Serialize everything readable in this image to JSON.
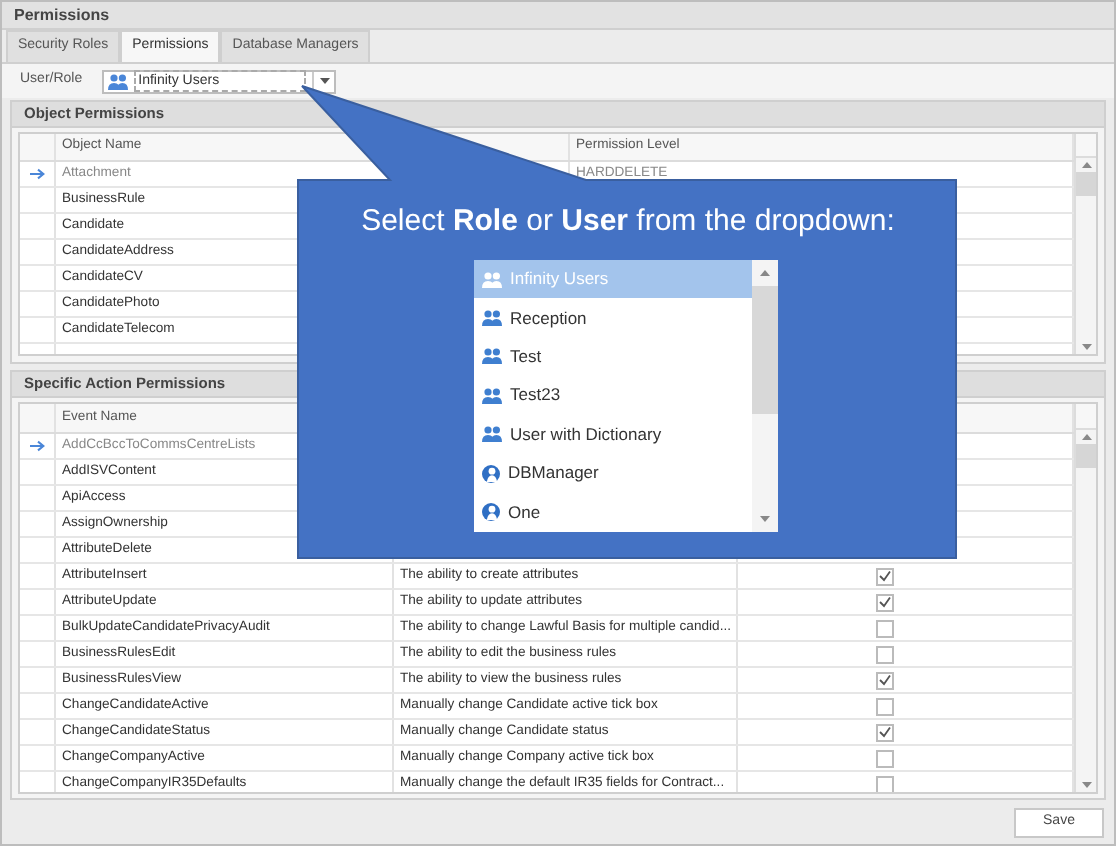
{
  "window": {
    "title": "Permissions"
  },
  "tabs": [
    {
      "label": "Security Roles",
      "selected": false
    },
    {
      "label": "Permissions",
      "selected": true
    },
    {
      "label": "Database Managers",
      "selected": false
    }
  ],
  "user_role": {
    "label": "User/Role",
    "value": "Infinity Users"
  },
  "object_permissions": {
    "title": "Object Permissions",
    "columns": [
      "Object Name",
      "Permission Level"
    ],
    "rows": [
      {
        "name": "Attachment",
        "level": "HARDDELETE",
        "selected": true
      },
      {
        "name": "BusinessRule",
        "selected": false
      },
      {
        "name": "Candidate",
        "selected": false
      },
      {
        "name": "CandidateAddress",
        "selected": false
      },
      {
        "name": "CandidateCV",
        "selected": false
      },
      {
        "name": "CandidatePhoto",
        "selected": false
      },
      {
        "name": "CandidateTelecom",
        "selected": false
      }
    ]
  },
  "action_permissions": {
    "title": "Specific Action Permissions",
    "columns": [
      "Event Name"
    ],
    "rows": [
      {
        "name": "AddCcBccToCommsCentreLists",
        "selected": true
      },
      {
        "name": "AddISVContent",
        "selected": false
      },
      {
        "name": "ApiAccess",
        "selected": false
      },
      {
        "name": "AssignOwnership",
        "selected": false
      },
      {
        "name": "AttributeDelete",
        "selected": false
      },
      {
        "name": "AttributeInsert",
        "description": "The ability to create attributes",
        "checked": true,
        "selected": false
      },
      {
        "name": "AttributeUpdate",
        "description": "The ability to update attributes",
        "checked": true,
        "selected": false
      },
      {
        "name": "BulkUpdateCandidatePrivacyAudit",
        "description": "The ability to change Lawful Basis for multiple candid...",
        "checked": false,
        "selected": false
      },
      {
        "name": "BusinessRulesEdit",
        "description": "The ability to edit the business rules",
        "checked": false,
        "selected": false
      },
      {
        "name": "BusinessRulesView",
        "description": "The ability to view the business rules",
        "checked": true,
        "selected": false
      },
      {
        "name": "ChangeCandidateActive",
        "description": "Manually change Candidate active tick box",
        "checked": false,
        "selected": false
      },
      {
        "name": "ChangeCandidateStatus",
        "description": "Manually change Candidate status",
        "checked": true,
        "selected": false
      },
      {
        "name": "ChangeCompanyActive",
        "description": "Manually change Company active tick box",
        "checked": false,
        "selected": false
      },
      {
        "name": "ChangeCompanyIR35Defaults",
        "description": "Manually change the default IR35 fields for Contract...",
        "checked": false,
        "selected": false
      }
    ]
  },
  "callout": {
    "text": "Select **Role** or **User** from the dropdown:",
    "options": [
      {
        "label": "Infinity Users",
        "kind": "group",
        "selected": true
      },
      {
        "label": "Reception",
        "kind": "group",
        "selected": false
      },
      {
        "label": "Test",
        "kind": "group",
        "selected": false
      },
      {
        "label": "Test23",
        "kind": "group",
        "selected": false
      },
      {
        "label": "User with Dictionary",
        "kind": "group",
        "selected": false
      },
      {
        "label": "DBManager",
        "kind": "user",
        "selected": false
      },
      {
        "label": "One",
        "kind": "user",
        "selected": false
      }
    ]
  },
  "save_button": "Save"
}
